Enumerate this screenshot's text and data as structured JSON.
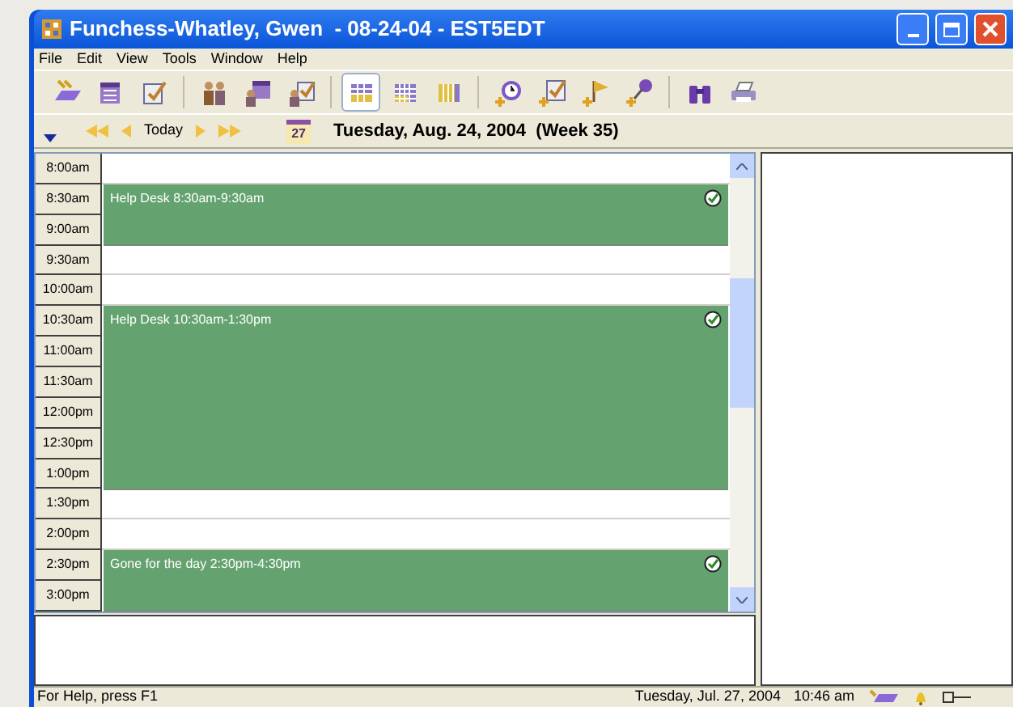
{
  "window": {
    "title": "Funchess-Whatley, Gwen  - 08-24-04 - EST5EDT"
  },
  "menu": [
    "File",
    "Edit",
    "View",
    "Tools",
    "Window",
    "Help"
  ],
  "toolbar": [
    {
      "kind": "sync",
      "selected": false
    },
    {
      "kind": "calendar",
      "selected": false
    },
    {
      "kind": "task",
      "selected": false
    },
    {
      "kind": "people",
      "selected": false
    },
    {
      "kind": "group-calendar",
      "selected": false
    },
    {
      "kind": "group-task",
      "selected": false
    },
    {
      "kind": "day-grid",
      "selected": true
    },
    {
      "kind": "week-grid",
      "selected": false
    },
    {
      "kind": "month-grid",
      "selected": false
    },
    {
      "kind": "add-clock",
      "selected": false
    },
    {
      "kind": "add-task",
      "selected": false
    },
    {
      "kind": "add-flag",
      "selected": false
    },
    {
      "kind": "add-pin",
      "selected": false
    },
    {
      "kind": "binoculars",
      "selected": false
    },
    {
      "kind": "printer",
      "selected": false
    }
  ],
  "navigation": {
    "today": "Today",
    "calendar_day": "27",
    "date": "Tuesday, Aug. 24, 2004  (Week 35)"
  },
  "schedule": [
    {
      "kind": "free",
      "times": [
        "8:00am"
      ]
    },
    {
      "kind": "appointment",
      "times": [
        "8:30am",
        "9:00am"
      ],
      "title": "Help Desk 8:30am-9:30am",
      "done": true
    },
    {
      "kind": "free",
      "times": [
        "9:30am",
        "10:00am"
      ]
    },
    {
      "kind": "appointment",
      "times": [
        "10:30am",
        "11:00am",
        "11:30am",
        "12:00pm",
        "12:30pm",
        "1:00pm"
      ],
      "title": "Help Desk 10:30am-1:30pm",
      "done": true
    },
    {
      "kind": "free",
      "times": [
        "1:30pm",
        "2:00pm"
      ]
    },
    {
      "kind": "appointment",
      "times": [
        "2:30pm",
        "3:00pm"
      ],
      "title": "Gone for the day 2:30pm-4:30pm",
      "done": true
    }
  ],
  "status_bar": {
    "help": "For Help, press F1",
    "date": "Tuesday, Jul. 27, 2004",
    "time": "10:46 am"
  }
}
